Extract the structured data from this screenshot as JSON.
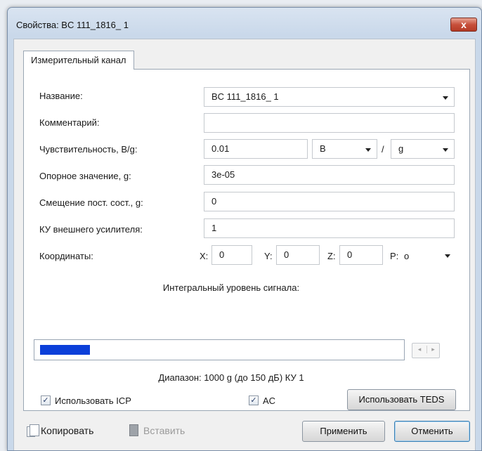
{
  "window": {
    "title": "Свойства: BC 111_1816_ 1",
    "close_glyph": "x"
  },
  "tabs": [
    {
      "label": "Измерительный канал"
    }
  ],
  "form": {
    "name_label": "Название:",
    "name_value": "BC 111_1816_ 1",
    "comment_label": "Комментарий:",
    "comment_value": "",
    "sensitivity_label": "Чувствительность, B/g:",
    "sensitivity_value": "0.01",
    "sensitivity_unit": "B",
    "sensitivity_slash": "/",
    "sensitivity_denom": "g",
    "reference_label": "Опорное значение, g:",
    "reference_value": "3e-05",
    "offset_label": "Смещение пост. сост., g:",
    "offset_value": "0",
    "gain_label": "КУ внешнего усилителя:",
    "gain_value": "1",
    "coords_label": "Координаты:",
    "x_label": "X:",
    "x_value": "0",
    "y_label": "Y:",
    "y_value": "0",
    "z_label": "Z:",
    "z_value": "0",
    "p_label": "P:",
    "p_value": "o"
  },
  "signal": {
    "label": "Интегральный уровень сигнала:",
    "level_fraction": 0.14,
    "fill_color": "#0b3fd9",
    "range_text": "Диапазон: 1000 g (до 150 дБ) КУ 1",
    "spinner_left": "◂",
    "spinner_right": "▸"
  },
  "options": {
    "use_icp_label": "Использовать ICP",
    "use_icp_checked": true,
    "ac_label": "AC",
    "ac_checked": true,
    "teds_button": "Использовать TEDS"
  },
  "footer": {
    "copy_label": "Копировать",
    "paste_label": "Вставить",
    "apply_label": "Применить",
    "cancel_label": "Отменить"
  },
  "check_glyph": "✓"
}
